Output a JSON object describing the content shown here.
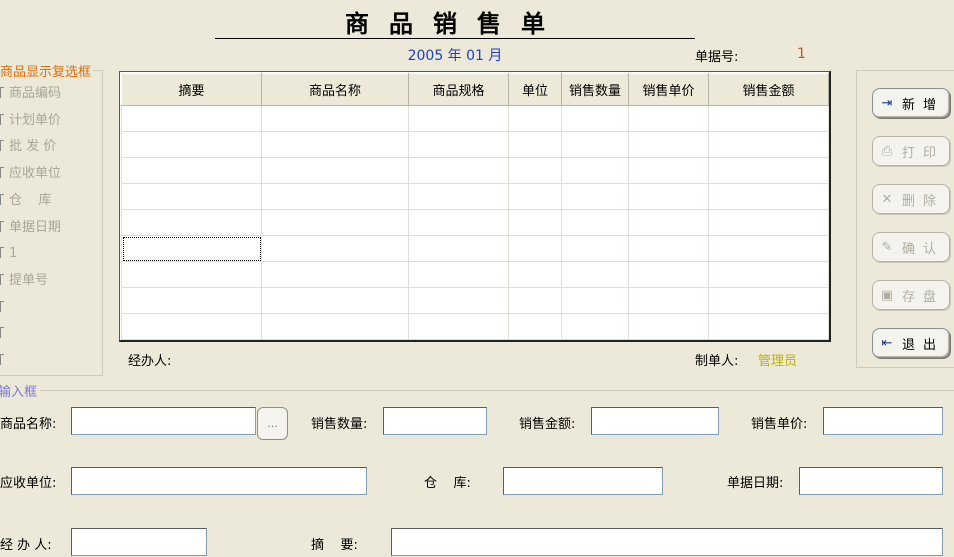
{
  "header": {
    "title": "商品销售单",
    "period": "2005 年 01 月",
    "doc_no_label": "单据号:",
    "doc_no_value": "1"
  },
  "checkbox_group": {
    "title": "商品显示复选框",
    "items": [
      {
        "label": "商品编码"
      },
      {
        "label": "计划单价"
      },
      {
        "label": "批 发 价"
      },
      {
        "label": "应收单位"
      },
      {
        "label": "仓    库"
      },
      {
        "label": "单据日期"
      },
      {
        "label": "1"
      },
      {
        "label": "提单号"
      },
      {
        "label": ""
      },
      {
        "label": ""
      },
      {
        "label": ""
      }
    ]
  },
  "table": {
    "columns": [
      "摘要",
      "商品名称",
      "商品规格",
      "单位",
      "销售数量",
      "销售单价",
      "销售金额"
    ],
    "row_count": 9
  },
  "footer": {
    "handler_label": "经办人:",
    "maker_label": "制单人:",
    "maker_value": "管理员"
  },
  "buttons": [
    {
      "icon": "new-icon",
      "label": "新增",
      "enabled": true
    },
    {
      "icon": "print-icon",
      "label": "打印",
      "enabled": false
    },
    {
      "icon": "delete-icon",
      "label": "删除",
      "enabled": false
    },
    {
      "icon": "confirm-icon",
      "label": "确认",
      "enabled": false
    },
    {
      "icon": "save-icon",
      "label": "存盘",
      "enabled": false
    },
    {
      "icon": "exit-icon",
      "label": "退出",
      "enabled": true
    }
  ],
  "input_box": {
    "title": "输入框",
    "product_name_label": "商品名称:",
    "product_name_value": "",
    "browse_label": "...",
    "sales_qty_label": "销售数量:",
    "sales_qty_value": "",
    "sales_amount_label": "销售金额:",
    "sales_amount_value": "",
    "sales_price_label": "销售单价:",
    "sales_price_value": "",
    "receivable_label": "应收单位:",
    "receivable_value": "",
    "warehouse_label": "仓    库:",
    "warehouse_value": "",
    "doc_date_label": "单据日期:",
    "doc_date_value": "",
    "handler_label": "经 办 人:",
    "handler_value": "",
    "summary_label": "摘    要:",
    "summary_value": ""
  }
}
